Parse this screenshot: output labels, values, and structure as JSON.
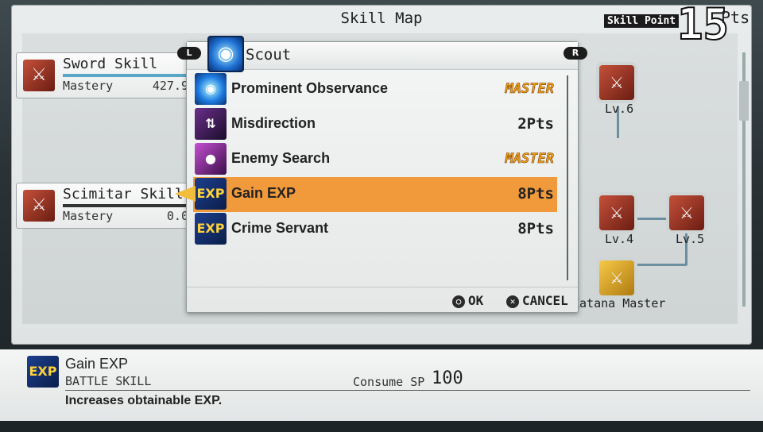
{
  "header": {
    "title": "Skill Map",
    "skill_point_label": "Skill Point",
    "skill_point_value": "15",
    "skill_point_unit": "Pts"
  },
  "skill_cards": [
    {
      "name": "Sword Skill",
      "mastery_label": "Mastery",
      "mastery_value": "427.9",
      "icon": "sword-icon"
    },
    {
      "name": "Scimitar Skill",
      "mastery_label": "Mastery",
      "mastery_value": "0.0",
      "icon": "scimitar-icon"
    }
  ],
  "map_nodes": [
    {
      "label": "Lv.6"
    },
    {
      "label": "Lv.4"
    },
    {
      "label": "Lv.5"
    },
    {
      "label": "Katana Master"
    }
  ],
  "popup": {
    "category": "Scout",
    "left_button": "L",
    "right_button": "R",
    "items": [
      {
        "name": "Prominent Observance",
        "value": "MASTER",
        "master": true,
        "icon": "eye-icon"
      },
      {
        "name": "Misdirection",
        "value": "2Pts",
        "master": false,
        "icon": "misdirection-icon"
      },
      {
        "name": "Enemy Search",
        "value": "MASTER",
        "master": true,
        "icon": "enemy-search-icon"
      },
      {
        "name": "Gain EXP",
        "value": "8Pts",
        "master": false,
        "selected": true,
        "icon": "exp-icon"
      },
      {
        "name": "Crime Servant",
        "value": "8Pts",
        "master": false,
        "icon": "exp-pt-icon"
      }
    ],
    "ok_label": "OK",
    "cancel_label": "CANCEL"
  },
  "info": {
    "name": "Gain EXP",
    "type": "BATTLE SKILL",
    "consume_label": "Consume SP",
    "consume_value": "100",
    "description": "Increases obtainable EXP.",
    "icon_text": "EXP"
  },
  "colors": {
    "selected_row": "#f09a3c",
    "master_text": "#f2a21a",
    "frame_bg": "#e9ecec"
  }
}
